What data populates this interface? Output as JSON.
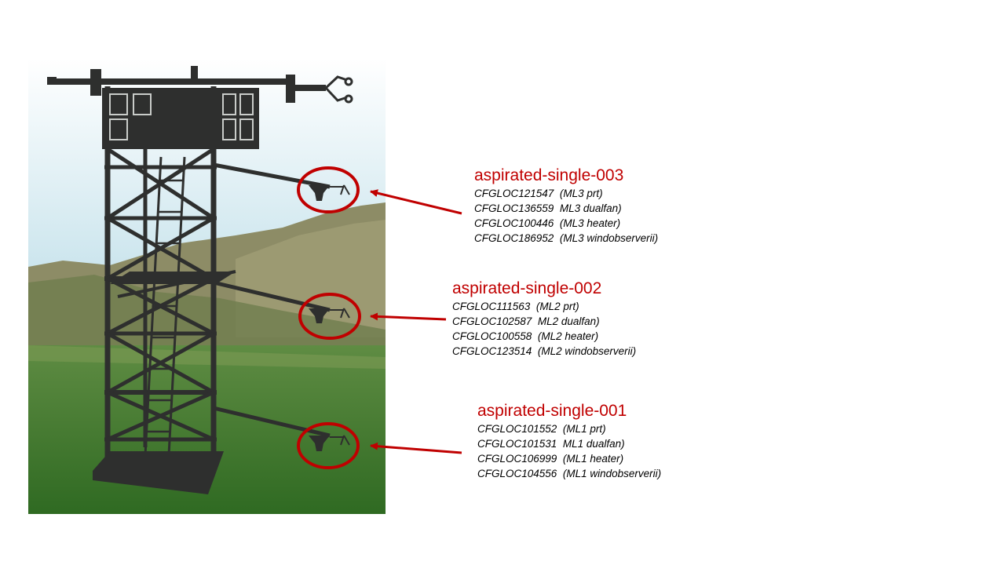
{
  "colors": {
    "accent": "#c00000",
    "tower": "#2e2f2e",
    "sky_top": "#ffffff",
    "sky_bottom": "#b9dbe6",
    "grass": "#3f7a2d",
    "hill": "#8a8a62"
  },
  "locations": [
    {
      "title": "aspirated-single-003",
      "sensors": [
        {
          "id": "CFGLOC121547",
          "desc": "(ML3 prt)"
        },
        {
          "id": "CFGLOC136559",
          "desc": "ML3 dualfan)"
        },
        {
          "id": "CFGLOC100446",
          "desc": "(ML3 heater)"
        },
        {
          "id": "CFGLOC186952",
          "desc": "(ML3 windobserverii)"
        }
      ]
    },
    {
      "title": "aspirated-single-002",
      "sensors": [
        {
          "id": "CFGLOC111563",
          "desc": "(ML2 prt)"
        },
        {
          "id": "CFGLOC102587",
          "desc": "ML2 dualfan)"
        },
        {
          "id": "CFGLOC100558",
          "desc": "(ML2 heater)"
        },
        {
          "id": "CFGLOC123514",
          "desc": "(ML2 windobserverii)"
        }
      ]
    },
    {
      "title": "aspirated-single-001",
      "sensors": [
        {
          "id": "CFGLOC101552",
          "desc": "(ML1 prt)"
        },
        {
          "id": "CFGLOC101531",
          "desc": "ML1 dualfan)"
        },
        {
          "id": "CFGLOC106999",
          "desc": "(ML1 heater)"
        },
        {
          "id": "CFGLOC104556",
          "desc": "(ML1 windobserverii)"
        }
      ]
    }
  ]
}
